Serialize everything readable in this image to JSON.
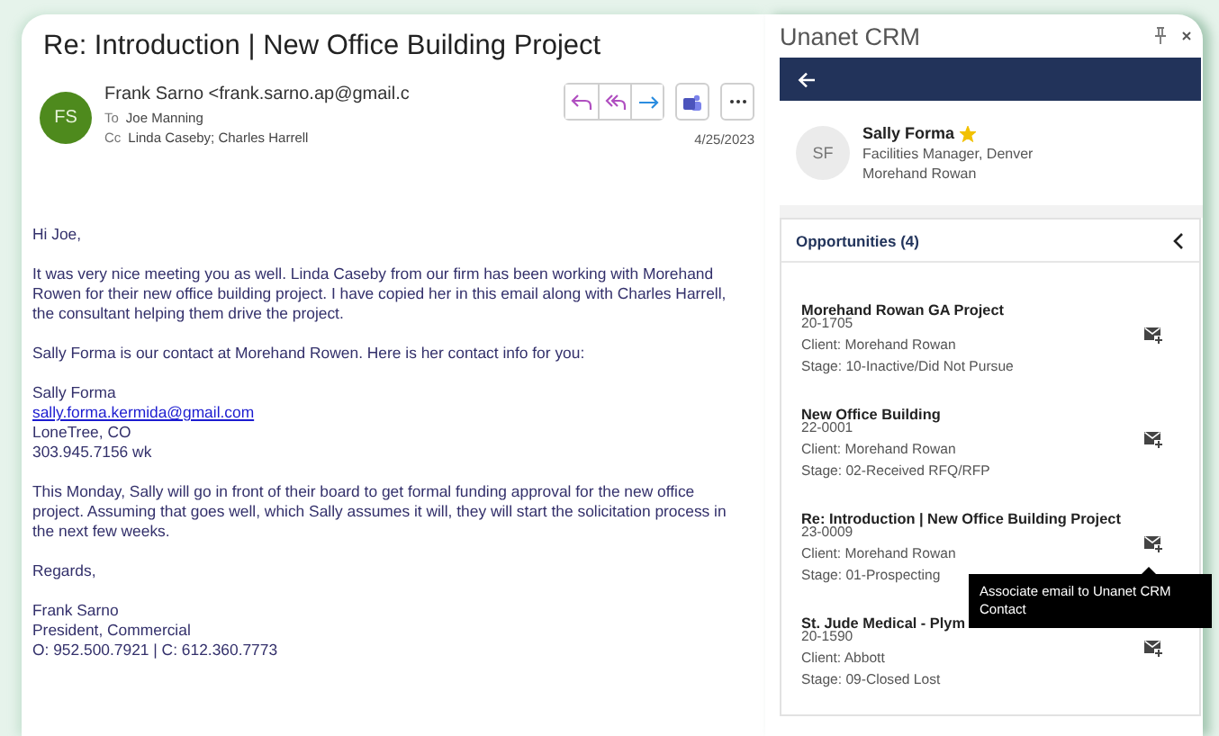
{
  "email": {
    "subject": "Re: Introduction | New Office Building Project",
    "sender_initials": "FS",
    "sender": "Frank Sarno <frank.sarno.ap@gmail.c",
    "to_label": "To",
    "to": "Joe Manning",
    "cc_label": "Cc",
    "cc": "Linda Caseby; Charles Harrell",
    "date": "4/25/2023",
    "actions": [
      {
        "kind": "reply"
      },
      {
        "kind": "reply_all"
      },
      {
        "kind": "forward"
      },
      {
        "kind": "teams"
      },
      {
        "kind": "more"
      }
    ],
    "body": [
      {
        "lines": [
          {
            "kind": "text",
            "text": "Hi Joe,"
          }
        ]
      },
      {
        "lines": [
          {
            "kind": "text",
            "text": "It was very nice meeting you as well. Linda Caseby from our firm has been working with Morehand"
          },
          {
            "kind": "text",
            "text": "Rowen for their new office building project. I have copied her in this email along with Charles Harrell,"
          },
          {
            "kind": "text",
            "text": "the consultant helping them drive the project."
          }
        ]
      },
      {
        "lines": [
          {
            "kind": "text",
            "text": "Sally Forma is our contact at Morehand Rowen. Here is her contact info for you:"
          }
        ]
      },
      {
        "lines": [
          {
            "kind": "text",
            "text": "Sally Forma"
          },
          {
            "kind": "link",
            "text": "sally.forma.kermida@gmail.com"
          },
          {
            "kind": "text",
            "text": "LoneTree, CO"
          },
          {
            "kind": "text",
            "text": "303.945.7156 wk"
          }
        ]
      },
      {
        "lines": [
          {
            "kind": "text",
            "text": "This Monday, Sally will go in front of their board to get formal funding approval for the new office"
          },
          {
            "kind": "text",
            "text": "project.  Assuming that goes well, which Sally assumes it will, they will start the solicitation process in"
          },
          {
            "kind": "text",
            "text": "the next few weeks."
          }
        ]
      },
      {
        "lines": [
          {
            "kind": "text",
            "text": "Regards,"
          }
        ]
      },
      {
        "lines": [
          {
            "kind": "text",
            "text": "Frank Sarno"
          },
          {
            "kind": "text",
            "text": "President, Commercial"
          },
          {
            "kind": "text",
            "text": "O: 952.500.7921 | C: 612.360.7773"
          }
        ]
      }
    ]
  },
  "crm": {
    "title": "Unanet CRM",
    "contact": {
      "initials": "SF",
      "name": "Sally Forma",
      "starred": true,
      "job": "Facilities Manager, Denver",
      "company": "Morehand Rowan"
    },
    "opportunities": {
      "header": "Opportunities (4)",
      "expanded": true,
      "items": [
        {
          "title": "Morehand Rowan GA Project",
          "number": "20-1705",
          "client": "Client: Morehand Rowan",
          "stage": "Stage: 10-Inactive/Did Not Pursue"
        },
        {
          "title": "New Office Building",
          "number": "22-0001",
          "client": "Client: Morehand Rowan",
          "stage": "Stage: 02-Received RFQ/RFP"
        },
        {
          "title": "Re: Introduction | New Office Building Project",
          "number": "23-0009",
          "client": "Client: Morehand Rowan",
          "stage": "Stage: 01-Prospecting"
        },
        {
          "title": "St. Jude Medical - Plym",
          "number": "20-1590",
          "client": "Client: Abbott",
          "stage": "Stage: 09-Closed Lost"
        }
      ]
    },
    "tooltip": {
      "text": "Associate email to Unanet CRM Contact"
    }
  }
}
